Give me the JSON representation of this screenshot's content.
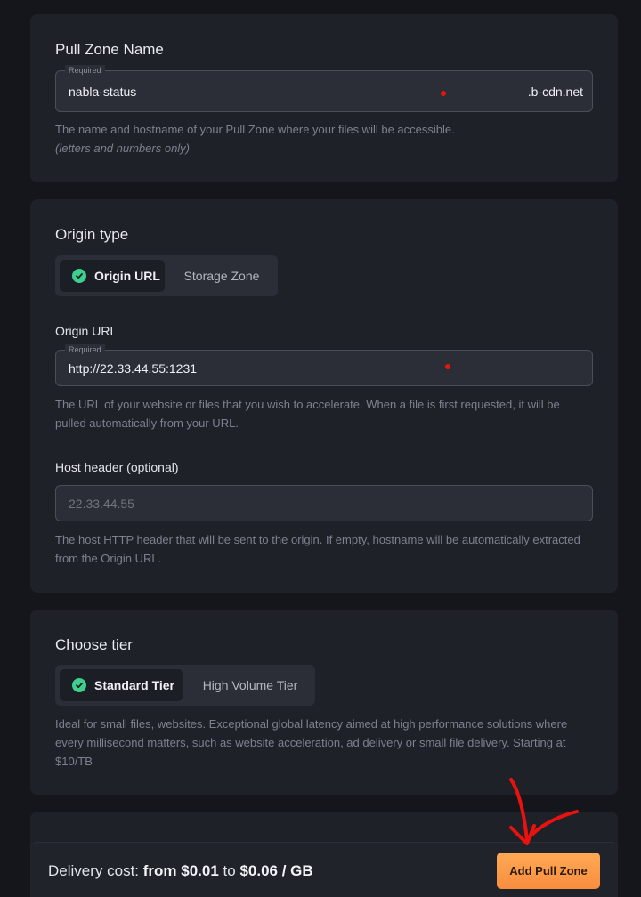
{
  "pull_zone_card": {
    "title": "Pull Zone Name",
    "required_label": "Required",
    "name_value": "nabla-status",
    "suffix": ".b-cdn.net",
    "help": "The name and hostname of your Pull Zone where your files will be accessible.",
    "help_note": "(letters and numbers only)"
  },
  "origin_card": {
    "title": "Origin type",
    "type_options": [
      {
        "label": "Origin URL",
        "selected": true
      },
      {
        "label": "Storage Zone",
        "selected": false
      }
    ],
    "origin_url_label": "Origin URL",
    "required_label": "Required",
    "origin_url_value": "http://22.33.44.55:1231",
    "origin_url_help": "The URL of your website or files that you wish to accelerate. When a file is first requested, it will be pulled automatically from your URL.",
    "host_header_label": "Host header (optional)",
    "host_header_placeholder": "22.33.44.55",
    "host_header_help": "The host HTTP header that will be sent to the origin. If empty, hostname will be automatically extracted from the Origin URL."
  },
  "tier_card": {
    "title": "Choose tier",
    "tier_options": [
      {
        "label": "Standard Tier",
        "selected": true
      },
      {
        "label": "High Volume Tier",
        "selected": false
      }
    ],
    "help": "Ideal for small files, websites. Exceptional global latency aimed at high performance solutions where every millisecond matters, such as website acceleration, ad delivery or small file delivery. Starting at $10/TB"
  },
  "footer": {
    "cost_label": "Delivery cost:",
    "cost_from": "from $0.01",
    "cost_to": "to",
    "cost_to_value": "$0.06 / GB",
    "add_button": "Add Pull Zone"
  },
  "colors": {
    "background": "#15161b",
    "card": "#1f2129",
    "accent_button": "#ffa04d",
    "check_green": "#3ecf8e",
    "annotation_red": "#e8130f"
  }
}
